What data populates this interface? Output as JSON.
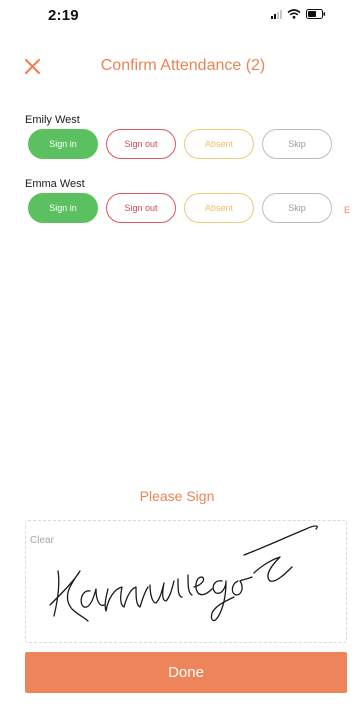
{
  "status_bar": {
    "time": "2:19"
  },
  "header": {
    "title": "Confirm Attendance (2)",
    "close_icon": "close-icon"
  },
  "attendees": [
    {
      "name": "Emily West",
      "buttons": {
        "sign_in": "Sign in",
        "sign_out": "Sign out",
        "absent": "Absent",
        "skip": "Skip"
      }
    },
    {
      "name": "Emma West",
      "buttons": {
        "sign_in": "Sign in",
        "sign_out": "Sign out",
        "absent": "Absent",
        "skip": "Skip"
      },
      "overflow_hint": "E"
    }
  ],
  "signature": {
    "title": "Please Sign",
    "clear_label": "Clear"
  },
  "done_label": "Done",
  "colors": {
    "accent": "#ee8459",
    "sign_in": "#5bc05f",
    "sign_out": "#d9585f",
    "absent": "#f5c77b",
    "skip": "#bdbdbd"
  }
}
